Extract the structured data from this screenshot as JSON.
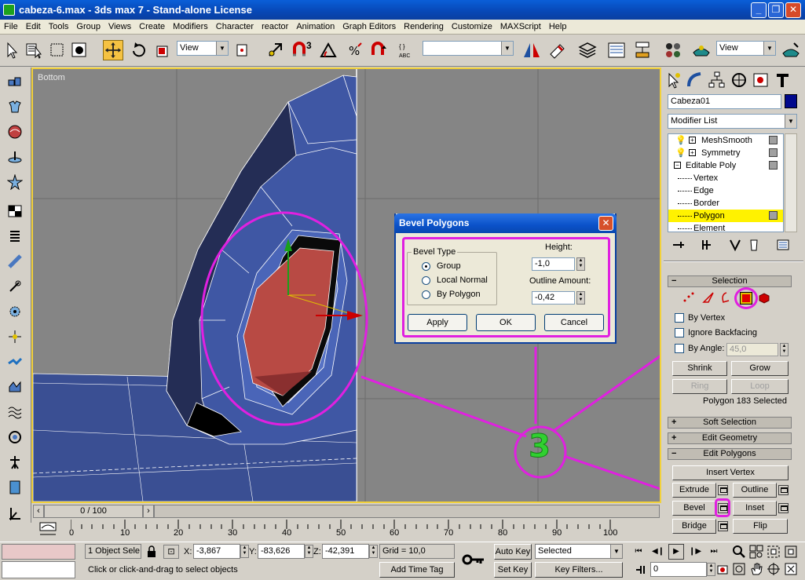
{
  "window": {
    "title": "cabeza-6.max - 3ds max 7 - Stand-alone License",
    "min_glyph": "_",
    "max_glyph": "❐",
    "close_glyph": "✕"
  },
  "menu": [
    "File",
    "Edit",
    "Tools",
    "Group",
    "Views",
    "Create",
    "Modifiers",
    "Character",
    "reactor",
    "Animation",
    "Graph Editors",
    "Rendering",
    "Customize",
    "MAXScript",
    "Help"
  ],
  "toolbar": {
    "ref_coord": "View",
    "snap_value": "3",
    "named_selection": "",
    "view_combo": "View"
  },
  "viewport": {
    "label": "Bottom"
  },
  "dialog": {
    "title": "Bevel Polygons",
    "group_label": "Bevel Type",
    "options": [
      "Group",
      "Local Normal",
      "By Polygon"
    ],
    "selected_option": "Group",
    "height_label": "Height:",
    "height_value": "-1,0",
    "outline_label": "Outline Amount:",
    "outline_value": "-0,42",
    "apply": "Apply",
    "ok": "OK",
    "cancel": "Cancel"
  },
  "annotation": {
    "number": "3",
    "color": "#e020e0",
    "number_color": "#30d030"
  },
  "command_panel": {
    "object_name": "Cabeza01",
    "object_color": "#00088c",
    "modifier_list": "Modifier List",
    "stack": [
      {
        "label": "MeshSmooth",
        "level": 0,
        "type": "modifier"
      },
      {
        "label": "Symmetry",
        "level": 0,
        "type": "modifier"
      },
      {
        "label": "Editable Poly",
        "level": 0,
        "type": "base"
      },
      {
        "label": "Vertex",
        "level": 1,
        "type": "sub"
      },
      {
        "label": "Edge",
        "level": 1,
        "type": "sub"
      },
      {
        "label": "Border",
        "level": 1,
        "type": "sub"
      },
      {
        "label": "Polygon",
        "level": 1,
        "type": "sub",
        "selected": true
      },
      {
        "label": "Element",
        "level": 1,
        "type": "sub"
      }
    ],
    "selection": {
      "header": "Selection",
      "by_vertex": "By Vertex",
      "ignore_backfacing": "Ignore Backfacing",
      "by_angle": "By Angle:",
      "angle_value": "45,0",
      "shrink": "Shrink",
      "grow": "Grow",
      "ring": "Ring",
      "loop": "Loop",
      "status": "Polygon 183 Selected"
    },
    "soft_selection": "Soft Selection",
    "edit_geometry": "Edit Geometry",
    "edit_polygons": {
      "header": "Edit Polygons",
      "insert_vertex": "Insert Vertex",
      "extrude": "Extrude",
      "outline": "Outline",
      "bevel": "Bevel",
      "inset": "Inset",
      "bridge": "Bridge",
      "flip": "Flip"
    }
  },
  "timeline": {
    "frame_label": "0 / 100",
    "ticks": [
      "0",
      "10",
      "20",
      "30",
      "40",
      "50",
      "60",
      "70",
      "80",
      "90",
      "100"
    ]
  },
  "status": {
    "selection": "1 Object Sele",
    "x_label": "X:",
    "x": "-3,867",
    "y_label": "Y:",
    "y": "-83,626",
    "z_label": "Z:",
    "z": "-42,391",
    "grid": "Grid = 10,0",
    "prompt": "Click or click-and-drag to select objects",
    "add_time_tag": "Add Time Tag",
    "auto_key": "Auto Key",
    "set_key": "Set Key",
    "selected": "Selected",
    "key_filters": "Key Filters...",
    "frame_value": "0"
  }
}
